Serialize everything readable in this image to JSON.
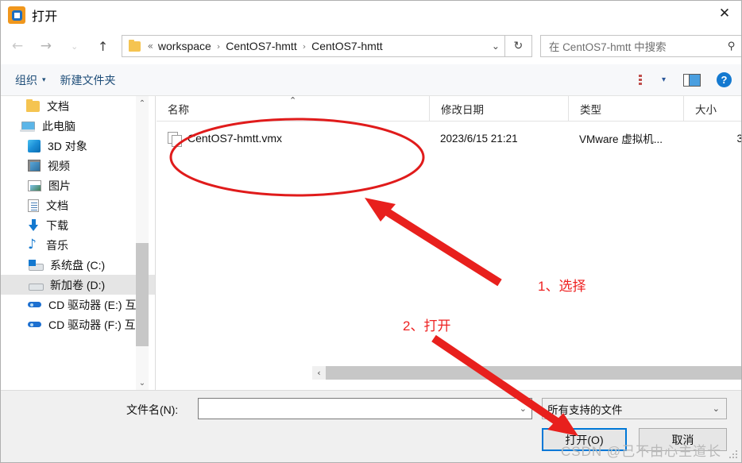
{
  "window": {
    "title": "打开",
    "app_icon": "vmware-logo-icon",
    "close_label": "✕"
  },
  "nav": {
    "back_icon": "←",
    "forward_icon": "→",
    "recent_icon": "⌄",
    "up_icon": "↑",
    "refresh_icon": "↻",
    "breadcrumb_prefix": "«",
    "breadcrumb": [
      "workspace",
      "CentOS7-hmtt",
      "CentOS7-hmtt"
    ],
    "breadcrumb_separator": "›",
    "breadcrumb_caret": "⌄"
  },
  "search": {
    "placeholder": "在 CentOS7-hmtt 中搜索",
    "icon": "search-icon"
  },
  "command_bar": {
    "organize": "组织",
    "organize_caret": "▾",
    "new_folder": "新建文件夹",
    "view_caret": "▾",
    "help": "?"
  },
  "sidebar": {
    "items": [
      {
        "label": "文档",
        "icon": "folder-icon",
        "indent": 1,
        "selected": false
      },
      {
        "label": "此电脑",
        "icon": "this-pc-icon",
        "indent": 2,
        "selected": false
      },
      {
        "label": "3D 对象",
        "icon": "3d-objects-icon",
        "indent": 3,
        "selected": false
      },
      {
        "label": "视频",
        "icon": "videos-icon",
        "indent": 3,
        "selected": false
      },
      {
        "label": "图片",
        "icon": "pictures-icon",
        "indent": 3,
        "selected": false
      },
      {
        "label": "文档",
        "icon": "documents-icon",
        "indent": 3,
        "selected": false
      },
      {
        "label": "下载",
        "icon": "downloads-icon",
        "indent": 3,
        "selected": false
      },
      {
        "label": "音乐",
        "icon": "music-icon",
        "indent": 3,
        "selected": false
      },
      {
        "label": "系统盘 (C:)",
        "icon": "system-drive-icon",
        "indent": 3,
        "selected": false
      },
      {
        "label": "新加卷 (D:)",
        "icon": "drive-icon",
        "indent": 3,
        "selected": true
      },
      {
        "label": "CD 驱动器 (E:) 互",
        "icon": "cd-drive-icon",
        "indent": 3,
        "selected": false
      },
      {
        "label": "CD 驱动器 (F:) 互",
        "icon": "cd-drive-icon",
        "indent": 3,
        "selected": false
      }
    ],
    "scroll_up_icon": "⌃",
    "scroll_down_icon": "⌄"
  },
  "file_list": {
    "columns": [
      {
        "label": "名称",
        "sorted": true,
        "sort_icon": "⌃"
      },
      {
        "label": "修改日期",
        "sorted": false
      },
      {
        "label": "类型",
        "sorted": false
      },
      {
        "label": "大小",
        "sorted": false
      }
    ],
    "rows": [
      {
        "name": "CentOS7-hmtt.vmx",
        "modified": "2023/6/15 21:21",
        "type": "VMware 虚拟机...",
        "size": "3",
        "icon": "vmx-file-icon"
      }
    ],
    "hscroll_left_icon": "‹",
    "hscroll_right_icon": "›"
  },
  "footer": {
    "filename_label": "文件名(N):",
    "filename_value": "",
    "filename_caret": "⌄",
    "filetype_value": "所有支持的文件",
    "filetype_caret": "⌄",
    "open_button": "打开(O)",
    "cancel_button": "取消"
  },
  "annotations": {
    "step1": "1、选择",
    "step2": "2、打开",
    "accent_color": "#ee2222"
  },
  "watermark": "CSDN @己不由心主道长"
}
